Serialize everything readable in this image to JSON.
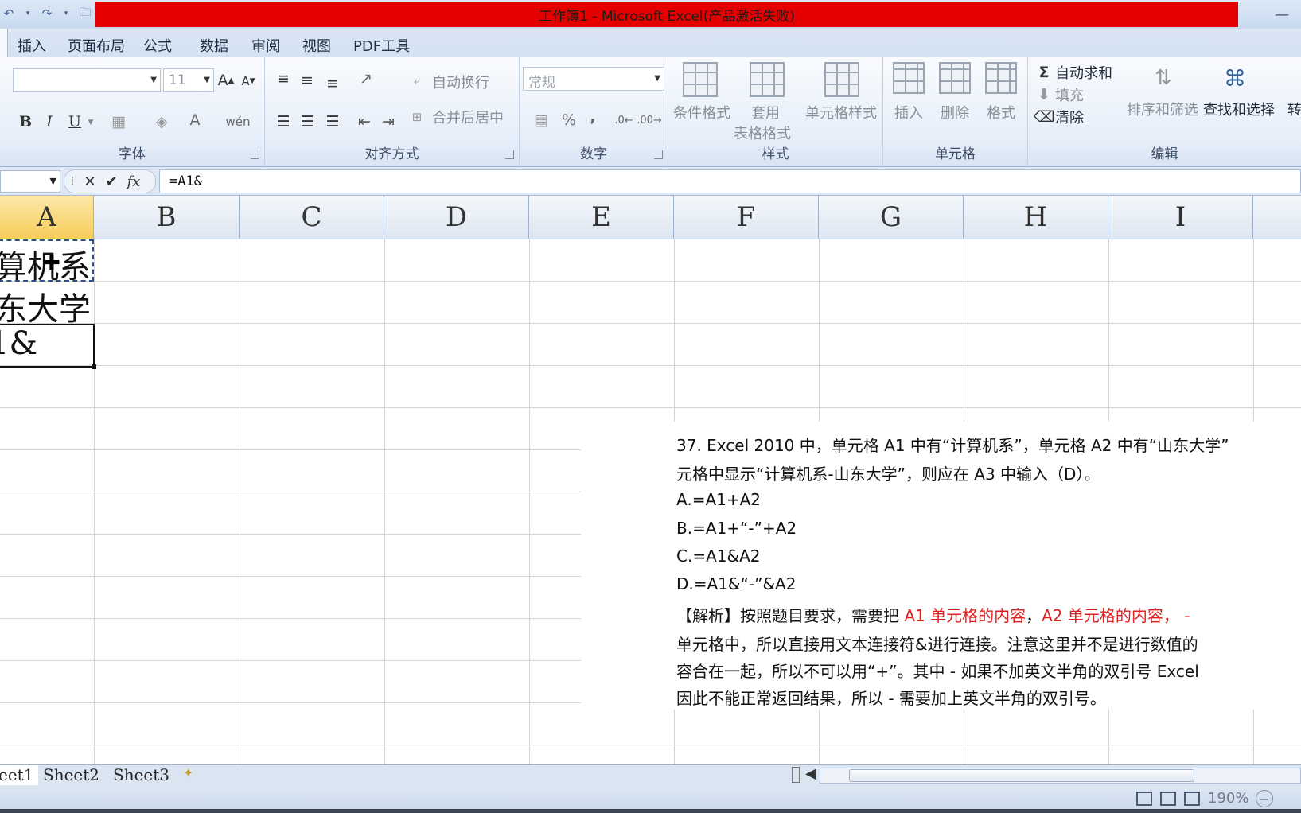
{
  "window": {
    "title": "工作簿1 - Microsoft Excel(产品激活失败)",
    "minimize": "—"
  },
  "ribbon_tabs": [
    "插入",
    "页面布局",
    "公式",
    "数据",
    "审阅",
    "视图",
    "PDF工具"
  ],
  "ribbon": {
    "font": {
      "label": "字体",
      "size": "11",
      "bold": "B",
      "italic": "I",
      "underline": "U"
    },
    "alignment": {
      "label": "对齐方式",
      "wrap_text": "自动换行",
      "merge_center": "合并后居中"
    },
    "number": {
      "label": "数字",
      "format": "常规",
      "percent": "%",
      "comma": ","
    },
    "styles": {
      "label": "样式",
      "conditional": "条件格式",
      "table_format_1": "套用",
      "table_format_2": "表格格式",
      "cell_styles": "单元格样式"
    },
    "cells": {
      "label": "单元格",
      "insert": "插入",
      "delete": "删除",
      "format": "格式"
    },
    "editing": {
      "label": "编辑",
      "autosum": "自动求和",
      "fill": "填充",
      "clear": "清除",
      "sort_filter": "排序和筛选",
      "find_select": "查找和选择",
      "convert": "转"
    }
  },
  "formula_bar": {
    "fx": "fx",
    "formula": "=A1&"
  },
  "columns": [
    "A",
    "B",
    "C",
    "D",
    "E",
    "F",
    "G",
    "H",
    "I"
  ],
  "cells": {
    "a1": "算机系",
    "a2": "东大学",
    "a3": "1&"
  },
  "note": {
    "line1": "37. Excel 2010 中，单元格 A1 中有“计算机系”，单元格 A2 中有“山东大学”",
    "line2": "元格中显示“计算机系-山东大学”，则应在 A3 中输入（D）。",
    "opt_a": "A.=A1+A2",
    "opt_b": "B.=A1+“-”+A2",
    "opt_c": "C.=A1&A2",
    "opt_d": "D.=A1&“-”&A2",
    "exp_prefix": "【解析】按照题目要求，需要把 ",
    "exp_red1": "A1 单元格的内容",
    "exp_comma": "，",
    "exp_red2": "A2 单元格的内容",
    "exp_red3": "，  -",
    "exp_line2": "单元格中，所以直接用文本连接符&进行连接。注意这里并不是进行数值的",
    "exp_line3": "容合在一起，所以不可以用“+”。其中 - 如果不加英文半角的双引号 Excel",
    "exp_line4": "因此不能正常返回结果，所以  -   需要加上英文半角的双引号。"
  },
  "sheet_tabs": [
    "eet1",
    "Sheet2",
    "Sheet3"
  ],
  "status": {
    "zoom": "190%"
  }
}
